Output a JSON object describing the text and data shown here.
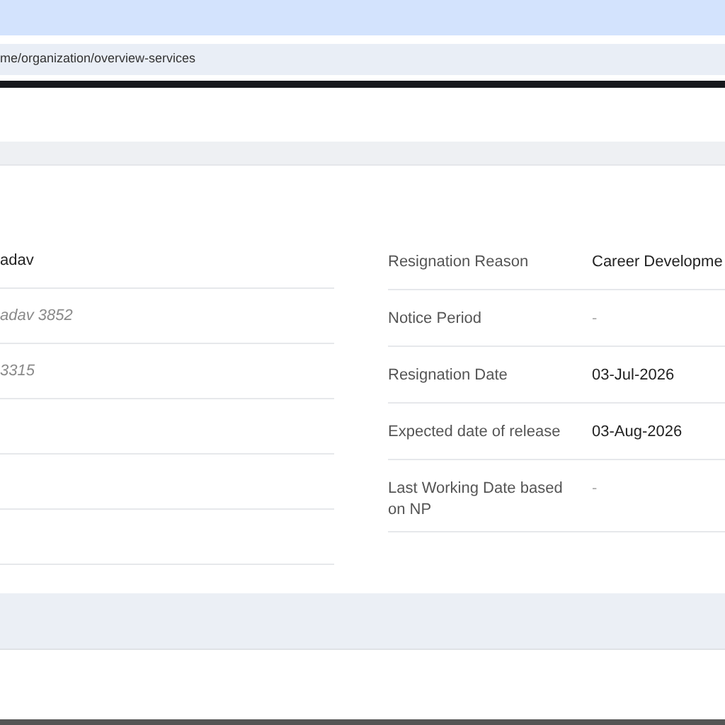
{
  "browser": {
    "url": "me/organization/overview-services"
  },
  "left_fields": [
    {
      "value": "adav",
      "kind": "plain"
    },
    {
      "placeholder": "adav 3852",
      "kind": "muted"
    },
    {
      "placeholder": "3315",
      "kind": "muted"
    },
    {
      "kind": "blank"
    },
    {
      "kind": "blank"
    },
    {
      "kind": "blank"
    }
  ],
  "right_fields": [
    {
      "label": "Resignation Reason",
      "value": "Career Developme"
    },
    {
      "label": "Notice Period",
      "value": "-"
    },
    {
      "label": "Resignation Date",
      "value": "03-Jul-2026"
    },
    {
      "label": "Expected date of release",
      "value": "03-Aug-2026"
    },
    {
      "label": "Last Working Date based on NP",
      "value": "-"
    }
  ]
}
